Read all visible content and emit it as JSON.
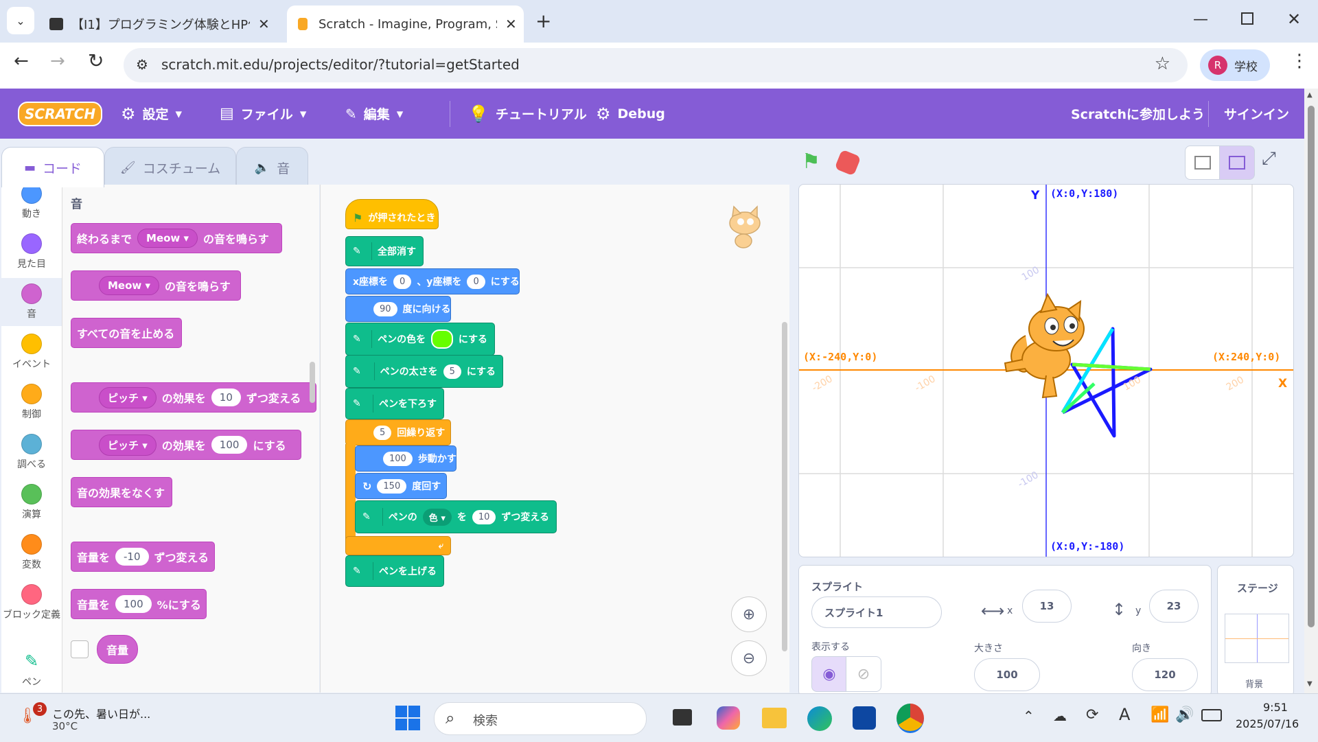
{
  "browser": {
    "tabs": [
      {
        "title": "【I1】プログラミング体験とHP作成実",
        "active": false
      },
      {
        "title": "Scratch - Imagine, Program, Sha",
        "active": true
      }
    ],
    "url": "scratch.mit.edu/projects/editor/?tutorial=getStarted",
    "profile_initial": "R",
    "profile_label": "学校"
  },
  "menu": {
    "logo": "SCRATCH",
    "settings": "設定",
    "file": "ファイル",
    "edit": "編集",
    "tutorials": "チュートリアル",
    "debug": "Debug",
    "join": "Scratchに参加しよう",
    "signin": "サインイン"
  },
  "editor_tabs": {
    "code": "コード",
    "costumes": "コスチューム",
    "sounds": "音"
  },
  "categories": [
    {
      "label": "動き",
      "color": "#4c97ff"
    },
    {
      "label": "見た目",
      "color": "#9966ff"
    },
    {
      "label": "音",
      "color": "#cf63cf"
    },
    {
      "label": "イベント",
      "color": "#ffbf00"
    },
    {
      "label": "制御",
      "color": "#ffab19"
    },
    {
      "label": "調べる",
      "color": "#5cb1d6"
    },
    {
      "label": "演算",
      "color": "#59c059"
    },
    {
      "label": "変数",
      "color": "#ff8c1a"
    },
    {
      "label": "ブロック定義",
      "color": "#ff6680"
    },
    {
      "label": "ペン",
      "color": "#0fbd8c"
    }
  ],
  "palette": {
    "heading": "音",
    "play_until_done": {
      "pre": "終わるまで",
      "drop": "Meow",
      "post": "の音を鳴らす"
    },
    "start_sound": {
      "drop": "Meow",
      "post": "の音を鳴らす"
    },
    "stop_all": "すべての音を止める",
    "change_effect": {
      "drop": "ピッチ",
      "mid": "の効果を",
      "val": "10",
      "post": "ずつ変える"
    },
    "set_effect": {
      "drop": "ピッチ",
      "mid": "の効果を",
      "val": "100",
      "post": "にする"
    },
    "clear_effects": "音の効果をなくす",
    "change_volume": {
      "pre": "音量を",
      "val": "-10",
      "post": "ずつ変える"
    },
    "set_volume": {
      "pre": "音量を",
      "val": "100",
      "post": "%にする"
    },
    "volume_reporter": "音量"
  },
  "script": {
    "when_flag": "が押されたとき",
    "clear": "全部消す",
    "goto": {
      "x_label": "x座標を",
      "x": "0",
      "y_label": "、y座標を",
      "y": "0",
      "post": "にする"
    },
    "point": {
      "val": "90",
      "post": "度に向ける"
    },
    "pen_color": {
      "pre": "ペンの色を",
      "post": "にする",
      "swatch": "#66ff00"
    },
    "pen_size": {
      "pre": "ペンの太さを",
      "val": "5",
      "post": "にする"
    },
    "pen_down": "ペンを下ろす",
    "repeat": {
      "val": "5",
      "post": "回繰り返す"
    },
    "move": {
      "val": "100",
      "post": "歩動かす"
    },
    "turn": {
      "val": "150",
      "post": "度回す"
    },
    "change_pen": {
      "pre": "ペンの",
      "drop": "色",
      "mid": "を",
      "val": "10",
      "post": "ずつ変える"
    },
    "pen_up": "ペンを上げる"
  },
  "stage": {
    "y_axis": "Y",
    "x_axis": "X",
    "top": "(X:0,Y:180)",
    "bottom": "(X:0,Y:-180)",
    "left": "(X:-240,Y:0)",
    "right": "(X:240,Y:0)",
    "ticks": {
      "y100": "100",
      "yneg100": "-100",
      "xneg200": "-200",
      "xneg100": "-100",
      "x100": "100",
      "x200": "200"
    }
  },
  "sprite_info": {
    "header": "スプライト",
    "name": "スプライト1",
    "x_label": "x",
    "x": "13",
    "y_label": "y",
    "y": "23",
    "show_label": "表示する",
    "size_label": "大きさ",
    "size": "100",
    "direction_label": "向き",
    "direction": "120"
  },
  "stage_panel": {
    "header": "ステージ",
    "backdrops": "背景"
  },
  "taskbar": {
    "weather_text": "この先、暑い日が...",
    "temp": "30°C",
    "badge": "3",
    "search": "検索",
    "time": "9:51",
    "date": "2025/07/16"
  }
}
